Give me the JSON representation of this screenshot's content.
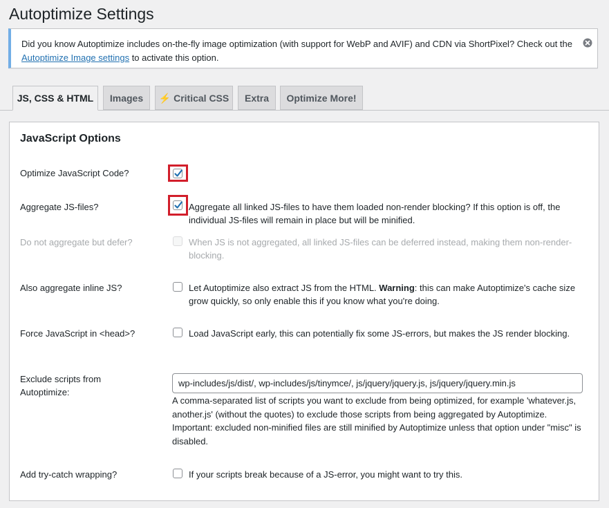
{
  "page": {
    "title": "Autoptimize Settings"
  },
  "notice": {
    "text_before": "Did you know Autoptimize includes on-the-fly image optimization (with support for WebP and AVIF) and CDN via ShortPixel? Check out the ",
    "link_text": "Autoptimize Image settings",
    "text_after": " to activate this option."
  },
  "tabs": [
    {
      "label": "JS, CSS & HTML",
      "active": true
    },
    {
      "label": "Images",
      "active": false
    },
    {
      "label": "⚡ Critical CSS",
      "active": false
    },
    {
      "label": "Extra",
      "active": false
    },
    {
      "label": "Optimize More!",
      "active": false
    }
  ],
  "section": {
    "title": "JavaScript Options"
  },
  "options": {
    "optimize_js": {
      "label": "Optimize JavaScript Code?",
      "checked": true
    },
    "aggregate_js": {
      "label": "Aggregate JS-files?",
      "checked": true,
      "description": "Aggregate all linked JS-files to have them loaded non-render blocking? If this option is off, the individual JS-files will remain in place but will be minified."
    },
    "defer_js": {
      "label": "Do not aggregate but defer?",
      "checked": false,
      "disabled": true,
      "description": "When JS is not aggregated, all linked JS-files can be deferred instead, making them non-render-blocking."
    },
    "inline_js": {
      "label": "Also aggregate inline JS?",
      "checked": false,
      "description_before": "Let Autoptimize also extract JS from the HTML. ",
      "description_strong": "Warning",
      "description_after": ": this can make Autoptimize's cache size grow quickly, so only enable this if you know what you're doing."
    },
    "force_head": {
      "label": "Force JavaScript in <head>?",
      "checked": false,
      "description": "Load JavaScript early, this can potentially fix some JS-errors, but makes the JS render blocking."
    },
    "exclude": {
      "label": "Exclude scripts from Autoptimize:",
      "value": "wp-includes/js/dist/, wp-includes/js/tinymce/, js/jquery/jquery.js, js/jquery/jquery.min.js",
      "help": "A comma-separated list of scripts you want to exclude from being optimized, for example 'whatever.js, another.js' (without the quotes) to exclude those scripts from being aggregated by Autoptimize. Important: excluded non-minified files are still minified by Autoptimize unless that option under \"misc\" is disabled."
    },
    "try_catch": {
      "label": "Add try-catch wrapping?",
      "checked": false,
      "description": "If your scripts break because of a JS-error, you might want to try this."
    }
  },
  "colors": {
    "highlight": "#d21e2b",
    "notice_border": "#72aee6",
    "link": "#2271b1"
  }
}
